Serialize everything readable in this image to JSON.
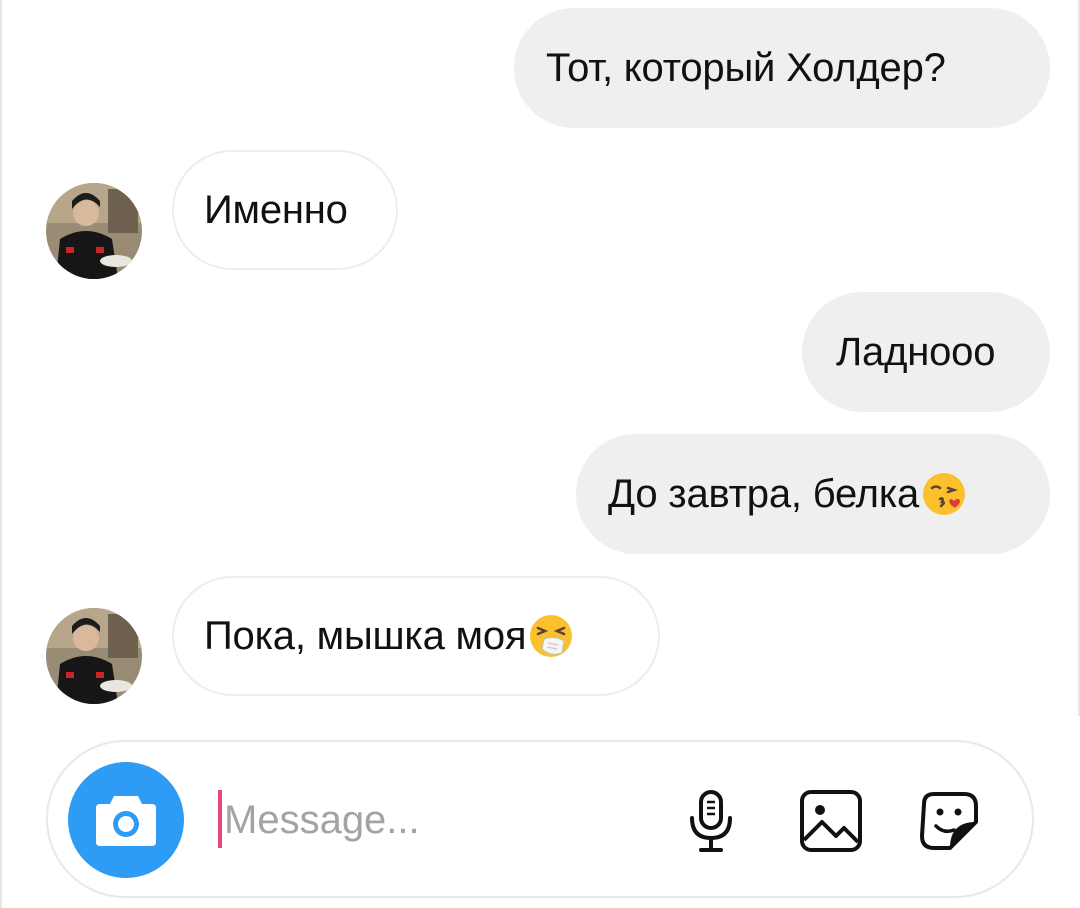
{
  "messages": [
    {
      "direction": "outgoing",
      "text": "Тот, который Холдер?"
    },
    {
      "direction": "incoming",
      "text": "Именно",
      "avatar": "user-avatar"
    },
    {
      "direction": "outgoing",
      "text": "Ладнооо"
    },
    {
      "direction": "outgoing",
      "text": "До завтра, белка",
      "emoji": "face-blowing-kiss-emoji"
    },
    {
      "direction": "incoming",
      "text": "Пока, мышка моя",
      "emoji": "sneezing-face-emoji",
      "avatar": "user-avatar"
    }
  ],
  "composer": {
    "placeholder": "Message...",
    "value": "",
    "buttons": [
      "camera-icon",
      "microphone-icon",
      "gallery-icon",
      "sticker-icon"
    ]
  },
  "colors": {
    "outgoing_bubble": "#efefef",
    "incoming_border": "#ededed",
    "camera_button": "#2e9bf4",
    "cursor": "#e6497a",
    "placeholder": "#a3a3a3"
  }
}
